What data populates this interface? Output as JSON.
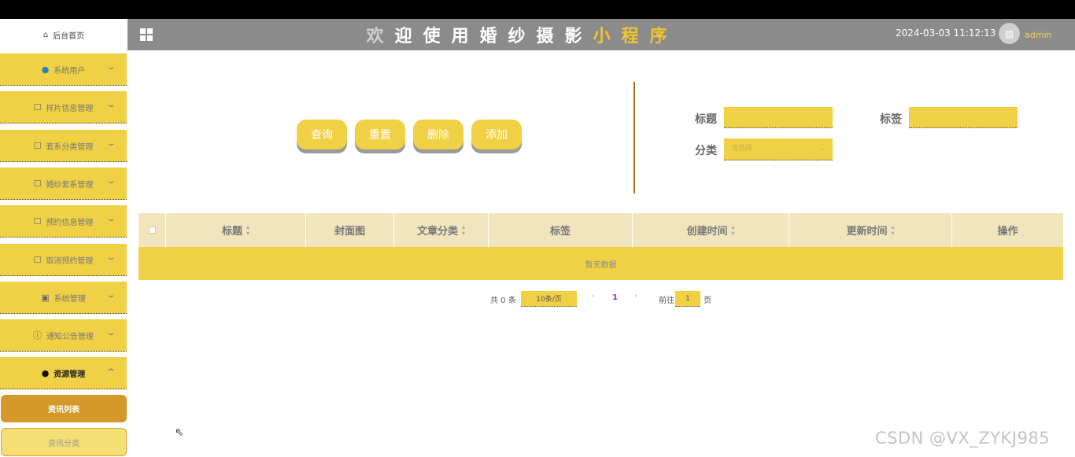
{
  "sidebar": {
    "home_label": "后台首页",
    "menu": [
      {
        "label": "系统用户",
        "icon": "user-icon"
      },
      {
        "label": "样片信息管理",
        "icon": "edit-icon"
      },
      {
        "label": "套系分类管理",
        "icon": "edit-icon"
      },
      {
        "label": "婚纱套系管理",
        "icon": "edit-icon"
      },
      {
        "label": "预约信息管理",
        "icon": "edit-icon"
      },
      {
        "label": "取消预约管理",
        "icon": "edit-icon"
      },
      {
        "label": "系统管理",
        "icon": "picture-icon"
      },
      {
        "label": "通知公告管理",
        "icon": "info-icon"
      },
      {
        "label": "资源管理",
        "icon": "location-icon"
      }
    ],
    "submenu": [
      {
        "label": "资讯列表",
        "active": true
      },
      {
        "label": "资讯分类",
        "active": false
      }
    ]
  },
  "header": {
    "title_chars": [
      "欢",
      "迎",
      "使",
      "用",
      "婚",
      "纱",
      "摄",
      "影",
      "小",
      "程",
      "序"
    ],
    "title_colors": [
      "#cfcfcf",
      "#ffffff",
      "#ffffff",
      "#ffffff",
      "#ffffff",
      "#ffffff",
      "#ffffff",
      "#ffffff",
      "#f4c430",
      "#f4c430",
      "#f4c430"
    ],
    "datetime": "2024-03-03 11:12:13",
    "username": "admin"
  },
  "toolbar": {
    "query_label": "查询",
    "reset_label": "重置",
    "delete_label": "删除",
    "add_label": "添加"
  },
  "filters": {
    "title_label": "标题",
    "tags_label": "标签",
    "category_label": "分类",
    "category_placeholder": "请选择"
  },
  "table": {
    "columns": [
      {
        "label": "标题",
        "sortable": true
      },
      {
        "label": "封面图",
        "sortable": false
      },
      {
        "label": "文章分类",
        "sortable": true
      },
      {
        "label": "标签",
        "sortable": false
      },
      {
        "label": "创建时间",
        "sortable": true
      },
      {
        "label": "更新时间",
        "sortable": true
      },
      {
        "label": "操作",
        "sortable": false
      }
    ],
    "empty_text": "暂无数据"
  },
  "pagination": {
    "total_text": "共 0 条",
    "page_size": "10条/页",
    "current_page": "1",
    "goto_label": "前往",
    "goto_value": "1",
    "page_unit": "页"
  },
  "watermark": "CSDN @VX_ZYKJ985",
  "colors": {
    "accent": "#f0d146",
    "header_bg": "#8b8b8b",
    "active_sub": "#d4982b",
    "divider": "#a56b1c"
  }
}
